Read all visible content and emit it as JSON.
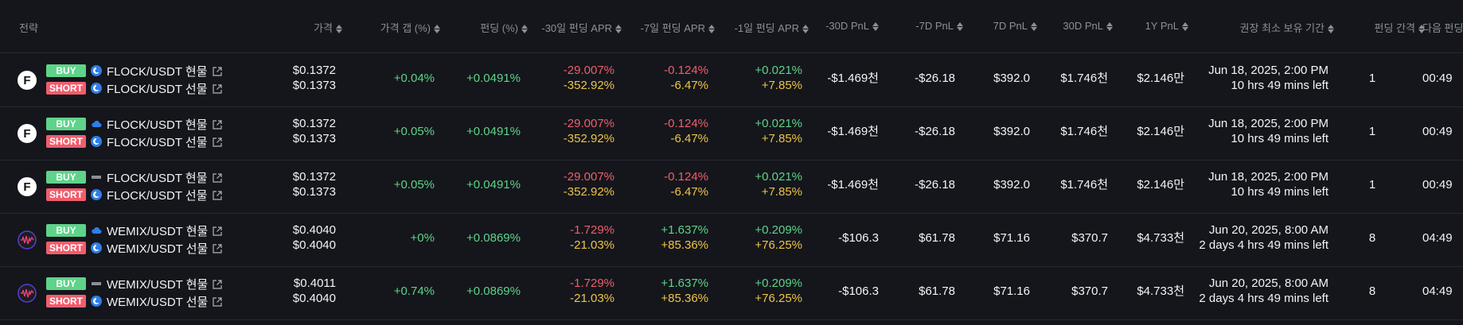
{
  "headers": {
    "strategy": "전략",
    "price": "가격",
    "price_gap": "가격 갭 (%)",
    "funding": "펀딩 (%)",
    "apr30": "-30일 펀딩 APR",
    "apr7": "-7일 펀딩 APR",
    "apr1": "-1일 펀딩 APR",
    "pnl30neg": "-30D PnL",
    "pnl7neg": "-7D PnL",
    "pnl7": "7D PnL",
    "pnl30": "30D PnL",
    "pnl1y": "1Y PnL",
    "hold": "권장 최소 보유 기간",
    "interval": "펀딩 간격",
    "next": "다음 펀딩까"
  },
  "rows": [
    {
      "avatar": "F",
      "buy_label": "BUY",
      "buy_pair": "FLOCK/USDT 현물",
      "buy_exchange_icon": "blue-exchange-icon",
      "short_label": "SHORT",
      "short_pair": "FLOCK/USDT 선물",
      "short_exchange_icon": "blue-exchange-icon",
      "price_top": "$0.1372",
      "price_bottom": "$0.1373",
      "gap": "+0.04%",
      "funding": "+0.0491%",
      "apr30_top": "-29.007%",
      "apr30_bottom": "-352.92%",
      "apr7_top": "-0.124%",
      "apr7_bottom": "-6.47%",
      "apr1_top": "+0.021%",
      "apr1_bottom": "+7.85%",
      "pnl30neg": "-$1.469천",
      "pnl7neg": "-$26.18",
      "pnl7": "$392.0",
      "pnl30": "$1.746천",
      "pnl1y": "$2.146만",
      "hold_top": "Jun 18, 2025, 2:00 PM",
      "hold_bottom": "10 hrs 49 mins left",
      "interval": "1",
      "next": "00:49"
    },
    {
      "avatar": "F",
      "buy_label": "BUY",
      "buy_pair": "FLOCK/USDT 현물",
      "buy_exchange_icon": "cloud-exchange-icon",
      "short_label": "SHORT",
      "short_pair": "FLOCK/USDT 선물",
      "short_exchange_icon": "blue-exchange-icon",
      "price_top": "$0.1372",
      "price_bottom": "$0.1373",
      "gap": "+0.05%",
      "funding": "+0.0491%",
      "apr30_top": "-29.007%",
      "apr30_bottom": "-352.92%",
      "apr7_top": "-0.124%",
      "apr7_bottom": "-6.47%",
      "apr1_top": "+0.021%",
      "apr1_bottom": "+7.85%",
      "pnl30neg": "-$1.469천",
      "pnl7neg": "-$26.18",
      "pnl7": "$392.0",
      "pnl30": "$1.746천",
      "pnl1y": "$2.146만",
      "hold_top": "Jun 18, 2025, 2:00 PM",
      "hold_bottom": "10 hrs 49 mins left",
      "interval": "1",
      "next": "00:49"
    },
    {
      "avatar": "F",
      "buy_label": "BUY",
      "buy_pair": "FLOCK/USDT 현물",
      "buy_exchange_icon": "bithumb-exchange-icon",
      "short_label": "SHORT",
      "short_pair": "FLOCK/USDT 선물",
      "short_exchange_icon": "blue-exchange-icon",
      "price_top": "$0.1372",
      "price_bottom": "$0.1373",
      "gap": "+0.05%",
      "funding": "+0.0491%",
      "apr30_top": "-29.007%",
      "apr30_bottom": "-352.92%",
      "apr7_top": "-0.124%",
      "apr7_bottom": "-6.47%",
      "apr1_top": "+0.021%",
      "apr1_bottom": "+7.85%",
      "pnl30neg": "-$1.469천",
      "pnl7neg": "-$26.18",
      "pnl7": "$392.0",
      "pnl30": "$1.746천",
      "pnl1y": "$2.146만",
      "hold_top": "Jun 18, 2025, 2:00 PM",
      "hold_bottom": "10 hrs 49 mins left",
      "interval": "1",
      "next": "00:49"
    },
    {
      "avatar": "W",
      "buy_label": "BUY",
      "buy_pair": "WEMIX/USDT 현물",
      "buy_exchange_icon": "cloud-exchange-icon",
      "short_label": "SHORT",
      "short_pair": "WEMIX/USDT 선물",
      "short_exchange_icon": "blue-exchange-icon",
      "price_top": "$0.4040",
      "price_bottom": "$0.4040",
      "gap": "+0%",
      "funding": "+0.0869%",
      "apr30_top": "-1.729%",
      "apr30_bottom": "-21.03%",
      "apr7_top": "+1.637%",
      "apr7_bottom": "+85.36%",
      "apr1_top": "+0.209%",
      "apr1_bottom": "+76.25%",
      "pnl30neg": "-$106.3",
      "pnl7neg": "$61.78",
      "pnl7": "$71.16",
      "pnl30": "$370.7",
      "pnl1y": "$4.733천",
      "hold_top": "Jun 20, 2025, 8:00 AM",
      "hold_bottom": "2 days 4 hrs 49 mins left",
      "interval": "8",
      "next": "04:49"
    },
    {
      "avatar": "W",
      "buy_label": "BUY",
      "buy_pair": "WEMIX/USDT 현물",
      "buy_exchange_icon": "bithumb-exchange-icon",
      "short_label": "SHORT",
      "short_pair": "WEMIX/USDT 선물",
      "short_exchange_icon": "blue-exchange-icon",
      "price_top": "$0.4011",
      "price_bottom": "$0.4040",
      "gap": "+0.74%",
      "funding": "+0.0869%",
      "apr30_top": "-1.729%",
      "apr30_bottom": "-21.03%",
      "apr7_top": "+1.637%",
      "apr7_bottom": "+85.36%",
      "apr1_top": "+0.209%",
      "apr1_bottom": "+76.25%",
      "pnl30neg": "-$106.3",
      "pnl7neg": "$61.78",
      "pnl7": "$71.16",
      "pnl30": "$370.7",
      "pnl1y": "$4.733천",
      "hold_top": "Jun 20, 2025, 8:00 AM",
      "hold_bottom": "2 days 4 hrs 49 mins left",
      "interval": "8",
      "next": "04:49"
    }
  ]
}
